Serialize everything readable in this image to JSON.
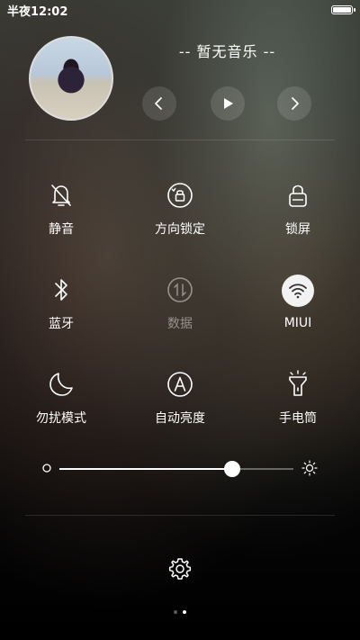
{
  "status_bar": {
    "time": "半夜12:02",
    "battery_level": 1.0
  },
  "music": {
    "title": "-- 暂无音乐 --",
    "prev_icon": "chevron-left-icon",
    "play_icon": "play-icon",
    "next_icon": "chevron-right-icon"
  },
  "toggles": [
    {
      "label": "静音",
      "icon": "bell-off-icon",
      "active": false,
      "dim": false
    },
    {
      "label": "方向锁定",
      "icon": "rotation-lock-icon",
      "active": false,
      "dim": false
    },
    {
      "label": "锁屏",
      "icon": "lock-icon",
      "active": false,
      "dim": false
    },
    {
      "label": "蓝牙",
      "icon": "bluetooth-icon",
      "active": false,
      "dim": false
    },
    {
      "label": "数据",
      "icon": "mobile-data-icon",
      "active": false,
      "dim": true
    },
    {
      "label": "MIUI",
      "icon": "wifi-icon",
      "active": true,
      "dim": false
    },
    {
      "label": "勿扰模式",
      "icon": "moon-icon",
      "active": false,
      "dim": false
    },
    {
      "label": "自动亮度",
      "icon": "auto-brightness-icon",
      "active": false,
      "dim": false
    },
    {
      "label": "手电筒",
      "icon": "flashlight-icon",
      "active": false,
      "dim": false
    }
  ],
  "brightness": {
    "level": 0.74
  },
  "settings": {
    "icon": "gear-icon"
  },
  "pager": {
    "page_count": 2,
    "current_page": 2
  },
  "colors": {
    "accent": "#ffffff",
    "active_bg": "#f2f2f2",
    "active_icon": "#333333"
  }
}
